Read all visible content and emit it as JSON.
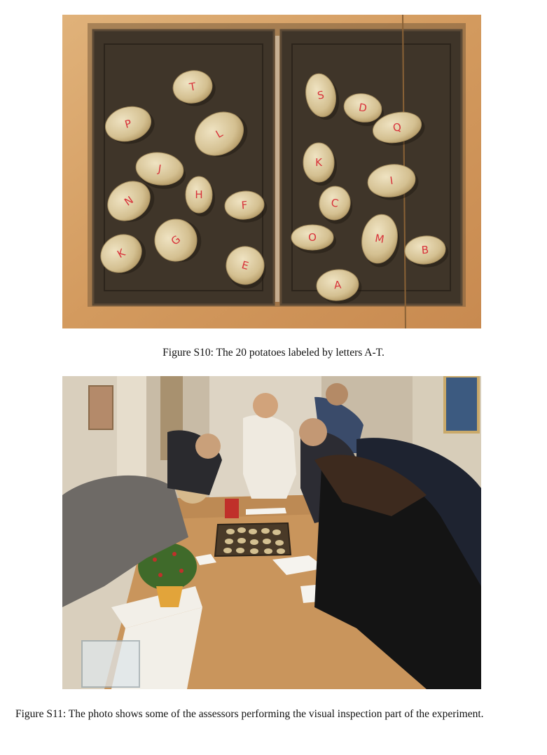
{
  "figures": [
    {
      "caption": "Figure S10: The 20 potatoes labeled by letters A-T.",
      "potato_labels": [
        "T",
        "P",
        "L",
        "J",
        "H",
        "N",
        "F",
        "G",
        "K",
        "E",
        "S",
        "D",
        "Q",
        "K",
        "I",
        "C",
        "O",
        "M",
        "B",
        "A"
      ]
    },
    {
      "caption": "Figure S11: The photo shows some of the assessors performing the visual inspection part of the experiment."
    }
  ],
  "colors": {
    "tray": "#3f3529",
    "table": "#c9955c",
    "potato": "#d8c69b",
    "label_ink": "#d8323a"
  }
}
